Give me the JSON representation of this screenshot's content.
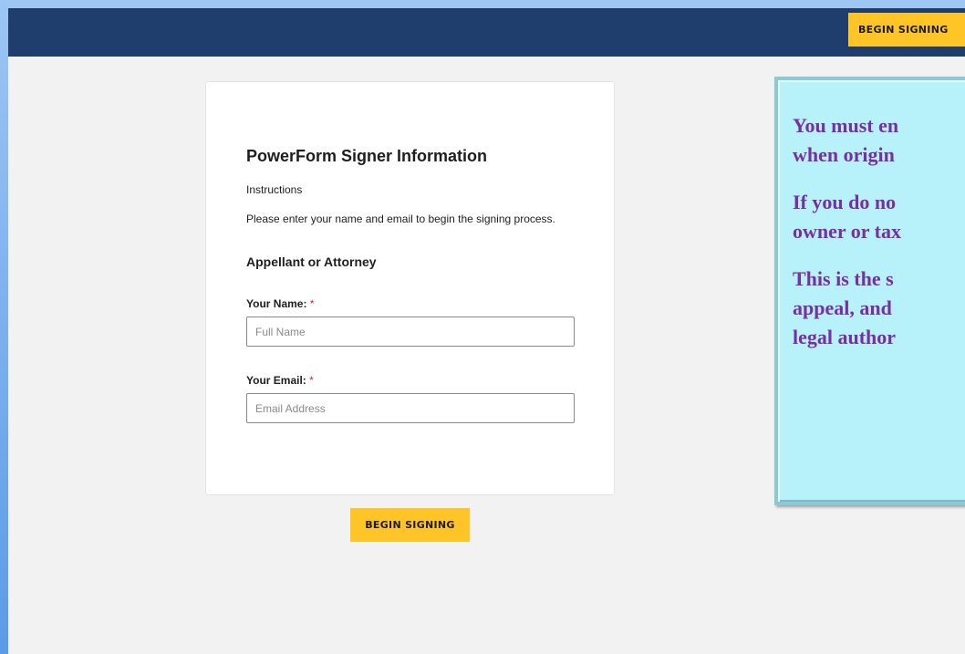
{
  "header": {
    "begin_label": "BEGIN SIGNING"
  },
  "form": {
    "title": "PowerForm Signer Information",
    "instructions_label": "Instructions",
    "instructions_text": "Please enter your name and email to begin the signing process.",
    "role": "Appellant or Attorney",
    "name_label": "Your Name:",
    "name_placeholder": "Full Name",
    "name_value": "",
    "email_label": "Your Email:",
    "email_placeholder": "Email Address",
    "email_value": "",
    "required_marker": "*",
    "submit_label": "BEGIN SIGNING"
  },
  "notice": {
    "lines": [
      "You must en",
      "when origin",
      "If you do no",
      "owner or tax",
      "This is the s",
      "appeal, and",
      "legal author"
    ]
  },
  "colors": {
    "header_bg": "#1f3e6e",
    "button_bg": "#ffc526",
    "notice_bg": "#b7f2fb",
    "notice_text": "#7a2ea4",
    "required": "#cc2a2a"
  }
}
